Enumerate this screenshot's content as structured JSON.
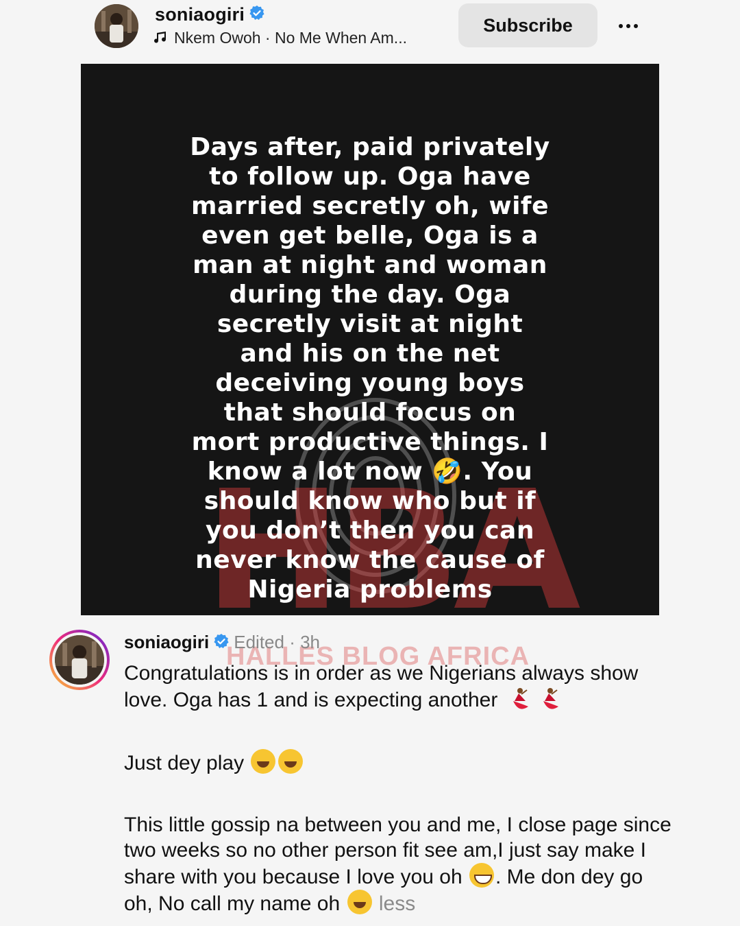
{
  "header": {
    "username": "soniaogiri",
    "verified_icon": "verified-badge-icon",
    "music_icon": "music-note-icon",
    "music_text": "Nkem Owoh · No Me When Am...",
    "subscribe_label": "Subscribe",
    "more_icon": "more-options-icon"
  },
  "story": {
    "lines": [
      "Days after, paid privately",
      "to follow up. Oga have",
      "married secretly oh, wife",
      "even get belle, Oga is a",
      "man at night and woman",
      "during the day. Oga",
      "secretly visit at night",
      "and his on the net",
      "deceiving young boys",
      "that should focus on",
      "mort productive things. I",
      "know a lot now 🤣. You",
      "should know who but if",
      "you don’t then you can",
      "never know the cause of",
      "Nigeria problems"
    ],
    "watermark_logo": "HBA"
  },
  "comment": {
    "username": "soniaogiri",
    "meta": "Edited · 3h",
    "watermark": "HALLES BLOG AFRICA",
    "para1": "Congratulations is in order as we Nigerians always show love. Oga has 1 and is expecting another",
    "para2": "Just dey play",
    "para3_a": "This little gossip na between you and me, I close page since two weeks so no other person fit see am,I just say make I share with you because I love you oh",
    "para3_b": ". Me don dey go oh, No call my name oh",
    "less_label": "less"
  },
  "colors": {
    "background": "#f5f5f5",
    "story_bg": "#151515",
    "verified": "#3897f0",
    "muted": "#888888",
    "watermark_red": "#d63c3c"
  }
}
